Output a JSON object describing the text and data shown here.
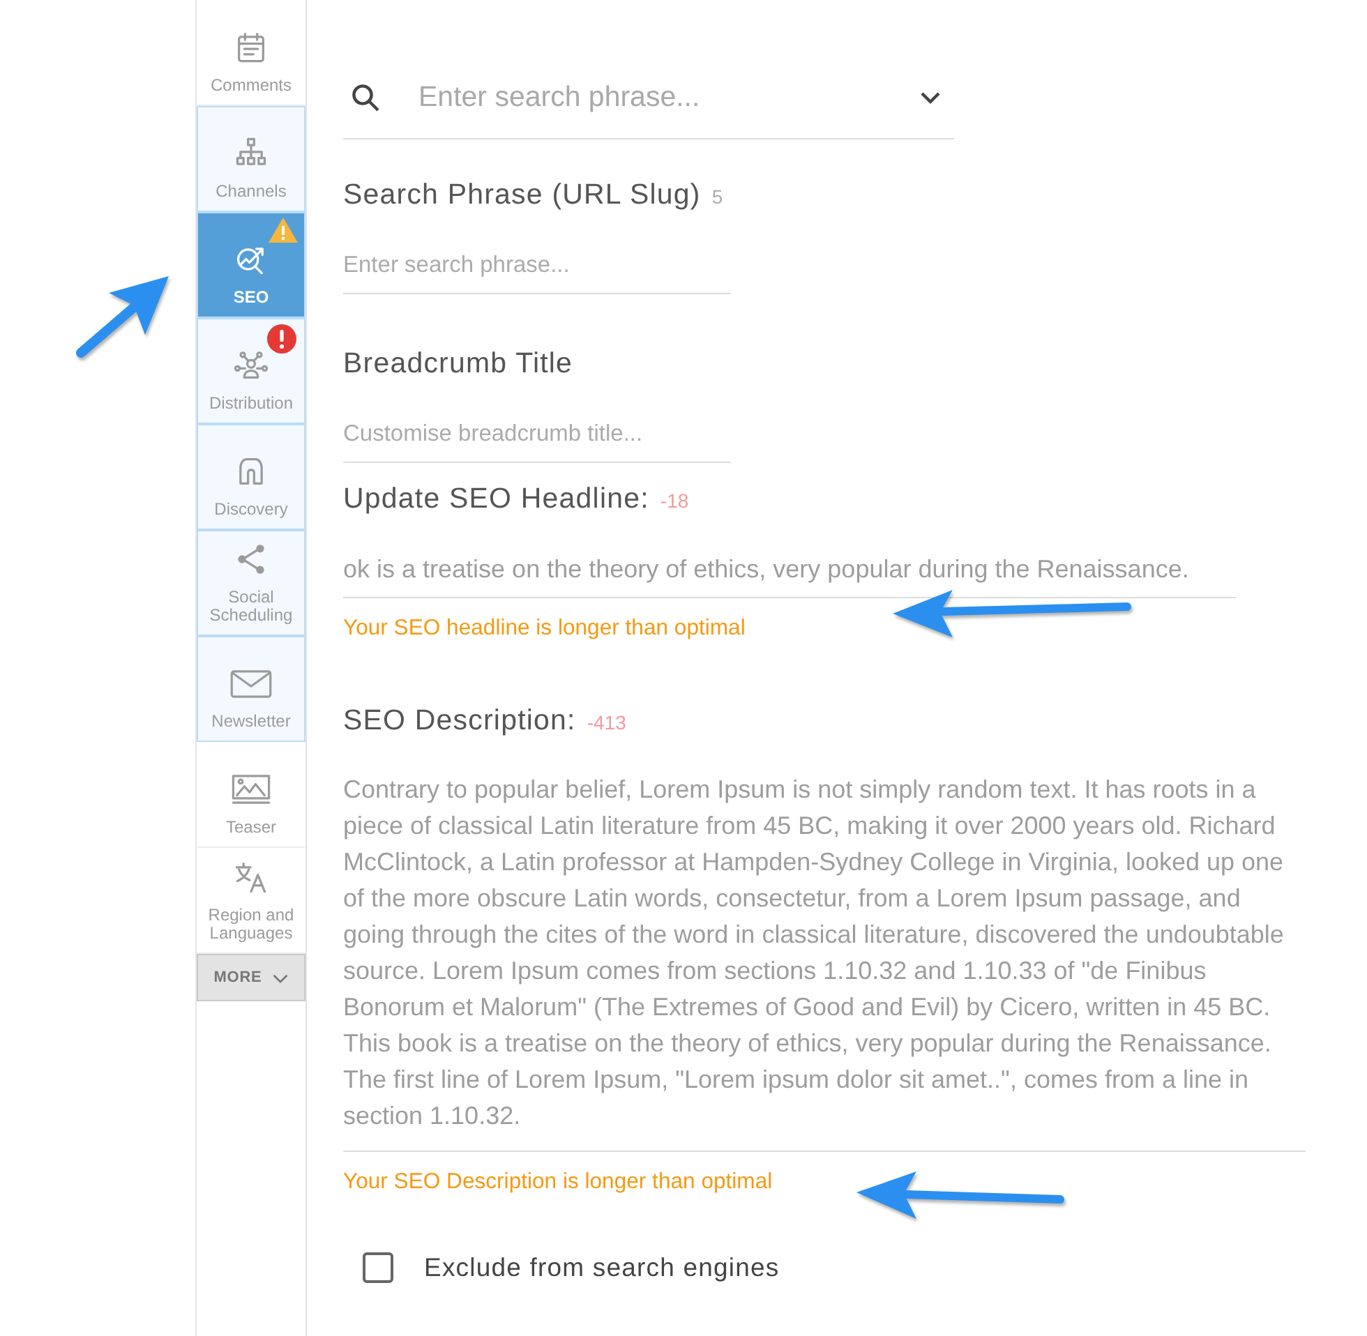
{
  "sidebar": {
    "items": [
      {
        "label": "Comments",
        "selected": false,
        "highlighted": false,
        "warning": false,
        "error": false,
        "annotated": false
      },
      {
        "label": "Channels",
        "selected": false,
        "highlighted": true,
        "warning": false,
        "error": false,
        "annotated": false
      },
      {
        "label": "SEO",
        "selected": true,
        "highlighted": true,
        "warning": true,
        "error": false,
        "annotated": true
      },
      {
        "label": "Distribution",
        "selected": false,
        "highlighted": true,
        "warning": false,
        "error": true,
        "annotated": false
      },
      {
        "label": "Discovery",
        "selected": false,
        "highlighted": true,
        "warning": false,
        "error": false,
        "annotated": false
      },
      {
        "label": "Social Scheduling",
        "selected": false,
        "highlighted": true,
        "warning": false,
        "error": false,
        "annotated": false
      },
      {
        "label": "Newsletter",
        "selected": false,
        "highlighted": true,
        "warning": false,
        "error": false,
        "annotated": false
      },
      {
        "label": "Teaser",
        "selected": false,
        "highlighted": false,
        "warning": false,
        "error": false,
        "annotated": false
      },
      {
        "label": "Region and Languages",
        "selected": false,
        "highlighted": false,
        "warning": false,
        "error": false,
        "annotated": false
      }
    ],
    "more_button": "MORE"
  },
  "search": {
    "placeholder": "Enter search phrase..."
  },
  "fields": [
    {
      "kind": "short",
      "label": "Search Phrase (URL Slug)",
      "count": "5",
      "over_limit": false,
      "placeholder": "Enter search phrase..."
    },
    {
      "kind": "short",
      "label": "Breadcrumb Title",
      "placeholder": "Customise breadcrumb title..."
    },
    {
      "kind": "wide",
      "label": "Update SEO Headline:",
      "count": "-18",
      "over_limit": true,
      "value": "ok is a treatise on the theory of ethics, very popular during the Renaissance.",
      "warning": "Your SEO headline is longer than optimal"
    },
    {
      "kind": "multiline",
      "label": "SEO Description:",
      "count": "-413",
      "over_limit": true,
      "value": "Contrary to popular belief, Lorem Ipsum is not simply random text. It has roots in a piece of classical Latin literature from 45 BC, making it over 2000 years old. Richard McClintock, a Latin professor at Hampden-Sydney College in Virginia, looked up one of the more obscure Latin words, consectetur, from a Lorem Ipsum passage, and going through the cites of the word in classical literature, discovered the undoubtable source. Lorem Ipsum comes from sections 1.10.32 and 1.10.33 of \"de Finibus Bonorum et Malorum\" (The Extremes of Good and Evil) by Cicero, written in 45 BC. This book is a treatise on the theory of ethics, very popular during the Renaissance. The first line of Lorem Ipsum, \"Lorem ipsum dolor sit amet..\", comes from a line in section 1.10.32.",
      "warning": "Your SEO Description is longer than optimal"
    }
  ],
  "exclude_checkbox": {
    "label": "Exclude from search engines",
    "checked": false
  }
}
